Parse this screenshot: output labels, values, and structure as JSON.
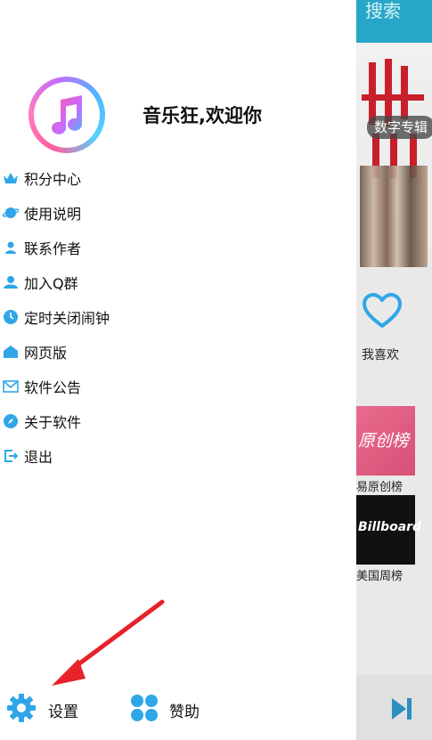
{
  "background_app": {
    "header_title": "搜索",
    "album_tag": "数字专辑",
    "favorite_label": "我喜欢",
    "charts": [
      {
        "art_text": "原创榜",
        "label": "易原创榜"
      },
      {
        "art_text": "Billboard",
        "label": "美国周榜"
      }
    ]
  },
  "drawer": {
    "welcome_text": "音乐狂,欢迎你",
    "menu_items": [
      {
        "label": "积分中心",
        "icon": "crown-icon"
      },
      {
        "label": "使用说明",
        "icon": "planet-icon"
      },
      {
        "label": "联系作者",
        "icon": "person-icon"
      },
      {
        "label": "加入Q群",
        "icon": "group-icon"
      },
      {
        "label": "定时关闭闹钟",
        "icon": "clock-icon"
      },
      {
        "label": "网页版",
        "icon": "home-icon"
      },
      {
        "label": "软件公告",
        "icon": "mail-icon"
      },
      {
        "label": "关于软件",
        "icon": "compass-icon"
      },
      {
        "label": "退出",
        "icon": "exit-icon"
      }
    ],
    "bottom": {
      "settings_label": "设置",
      "donate_label": "赞助"
    }
  },
  "colors": {
    "accent": "#2fa6e8",
    "header": "#27a7c8",
    "arrow": "#e8222a"
  }
}
